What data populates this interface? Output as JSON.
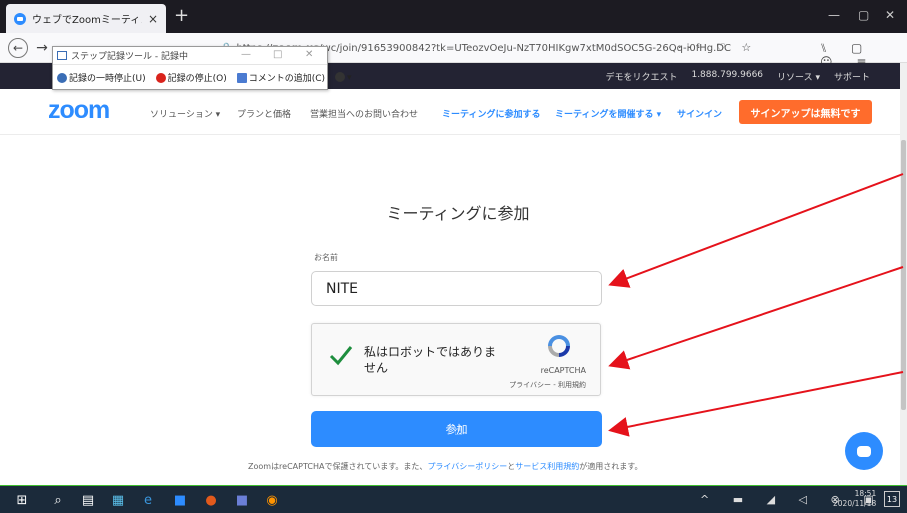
{
  "browser": {
    "tab_title": "ウェブでZoomミーティング - Zoom",
    "tab_close": "×",
    "new_tab": "+",
    "url_prefix": "https://",
    "url_host": "zoom.us",
    "url_path": "/wc/join/91653900842?tk=UTeozvOeJu-NzT70HIKgw7xtM0dSOC5G-26Qq-i0fHg.DC",
    "url_actions": "··· ♡ ☆",
    "nav_icons": "⑊ ▢ ☺ ≡",
    "win_min": "—",
    "win_max": "▢",
    "win_close": "✕"
  },
  "recorder": {
    "title": "ステップ記録ツール - 記録中",
    "pause_label": "記録の一時停止(U)",
    "stop_label": "記録の停止(O)",
    "comment_label": "コメントの追加(C)",
    "help_label": "▾",
    "minimize": "—",
    "maximize": "□",
    "close": "✕"
  },
  "zoom_topstrip": {
    "demo": "デモをリクエスト",
    "phone": "1.888.799.9666",
    "resources": "リソース ▾",
    "support": "サポート"
  },
  "zoom_nav": {
    "logo": "zoom",
    "solutions": "ソリューション ▾",
    "plans": "プランと価格",
    "contact_sales": "営業担当へのお問い合わせ",
    "join_meeting": "ミーティングに参加する",
    "host_meeting": "ミーティングを開催する ▾",
    "sign_in": "サインイン",
    "sign_up": "サインアップは無料です"
  },
  "form": {
    "heading": "ミーティングに参加",
    "name_label": "お名前",
    "name_value": "NITE",
    "captcha_text": "私はロボットではありません",
    "captcha_brand": "reCAPTCHA",
    "captcha_links": "プライバシー - 利用規約",
    "join_button": "参加",
    "disclaimer_prefix": "ZoomはreCAPTCHAで保護されています。また、",
    "privacy_link": "プライバシーポリシー",
    "disclaimer_and": "と",
    "terms_link": "サービス利用規約",
    "disclaimer_suffix": "が適用されます。"
  },
  "taskbar": {
    "tray_icons": "^ ▬ ◢ ◁ ⊗ ▣",
    "time": "18:51",
    "date": "2020/11/18",
    "notifications": "13"
  },
  "colors": {
    "zoom_blue": "#2d8cff",
    "signup_orange": "#ff6c2c",
    "annotation_red": "#e5121b",
    "taskbar": "#1b2a3a"
  }
}
